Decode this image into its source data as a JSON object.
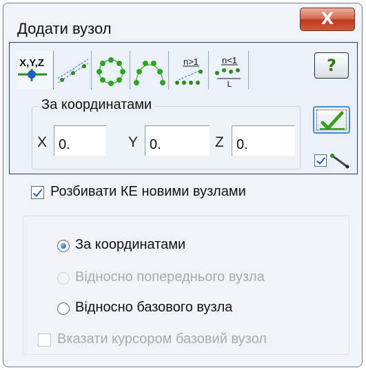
{
  "window": {
    "title": "Додати вузол",
    "close_label": "X"
  },
  "tabs": [
    {
      "name": "X,Y,Z"
    },
    {
      "name": "on-line"
    },
    {
      "name": "on-circle"
    },
    {
      "name": "on-arc"
    },
    {
      "name": "n>1"
    },
    {
      "name": "n<1"
    }
  ],
  "help_label": "?",
  "coords": {
    "group_label": "За координатами",
    "x_label": "X",
    "x_value": "0.",
    "y_label": "Y",
    "y_value": "0.",
    "z_label": "Z",
    "z_value": "0."
  },
  "ok_check_checked": true,
  "split": {
    "label": "Розбивати КЕ новими вузлами",
    "checked": true
  },
  "modes": {
    "by_coords": {
      "label": "За координатами",
      "selected": true,
      "enabled": true
    },
    "relative_prev": {
      "label": "Відносно попереднього вузла",
      "selected": false,
      "enabled": false
    },
    "relative_base": {
      "label": "Відносно базового вузла",
      "selected": false,
      "enabled": true
    }
  },
  "cursor_base": {
    "label": "Вказати курсором базовий вузол",
    "checked": false,
    "enabled": false
  },
  "colors": {
    "accent": "#1a55a8",
    "close": "#c0391d",
    "ok_check": "#3aa019"
  }
}
